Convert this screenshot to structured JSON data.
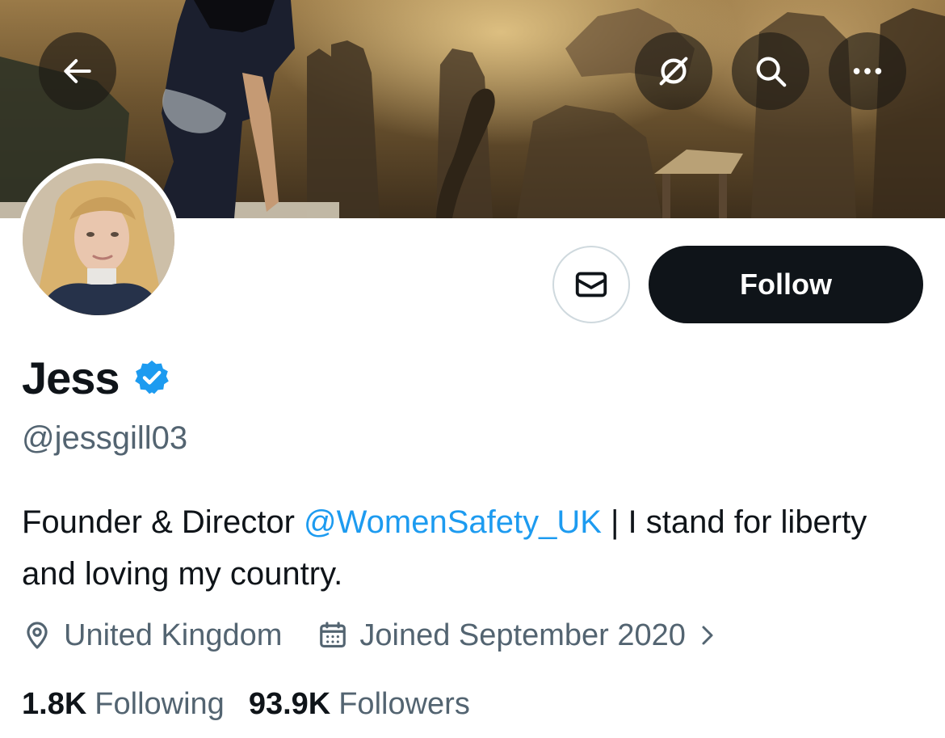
{
  "header": {
    "back_icon": "arrow-left-icon",
    "grok_icon": "grok-icon",
    "search_icon": "search-icon",
    "more_icon": "more-horizontal-icon"
  },
  "actions": {
    "message_icon": "envelope-icon",
    "follow_label": "Follow"
  },
  "profile": {
    "name": "Jess",
    "verified_icon": "verified-badge-icon",
    "handle": "@jessgill03",
    "bio_before": "Founder & Director ",
    "bio_mention": "@WomenSafety_UK",
    "bio_after": " | I stand for liberty and loving my country.",
    "location": "United Kingdom",
    "joined": "Joined September 2020"
  },
  "stats": {
    "following_count": "1.8K",
    "following_label": "Following",
    "followers_count": "93.9K",
    "followers_label": "Followers"
  },
  "colors": {
    "accent": "#1d9bf0",
    "text_primary": "#0f1419",
    "text_secondary": "#536471",
    "follow_bg": "#0f1419"
  }
}
